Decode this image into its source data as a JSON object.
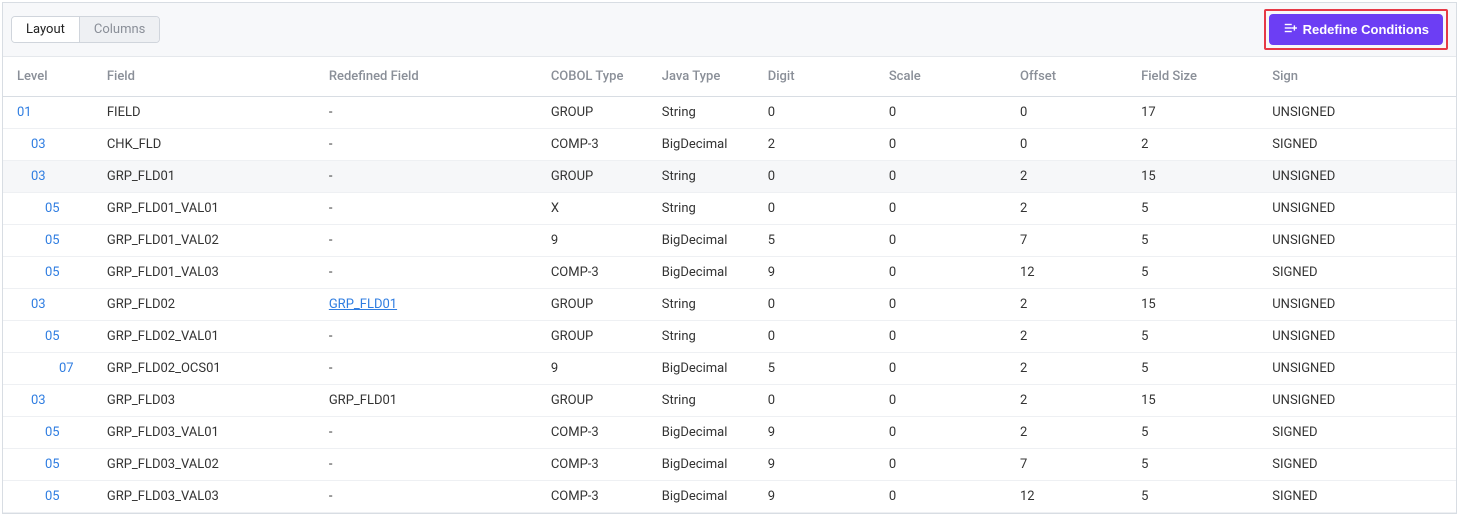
{
  "tabs": {
    "layout": "Layout",
    "columns": "Columns"
  },
  "button": {
    "redefine": "Redefine Conditions"
  },
  "columns": {
    "level": "Level",
    "field": "Field",
    "redefined": "Redefined Field",
    "cobol": "COBOL Type",
    "java": "Java Type",
    "digit": "Digit",
    "scale": "Scale",
    "offset": "Offset",
    "size": "Field Size",
    "sign": "Sign"
  },
  "rows": [
    {
      "level": "01",
      "indent": 0,
      "field": "FIELD",
      "redef": "-",
      "redefLink": false,
      "cobol": "GROUP",
      "java": "String",
      "digit": "0",
      "scale": "0",
      "offset": "0",
      "size": "17",
      "sign": "UNSIGNED",
      "hl": false
    },
    {
      "level": "03",
      "indent": 1,
      "field": "CHK_FLD",
      "redef": "-",
      "redefLink": false,
      "cobol": "COMP-3",
      "java": "BigDecimal",
      "digit": "2",
      "scale": "0",
      "offset": "0",
      "size": "2",
      "sign": "SIGNED",
      "hl": false
    },
    {
      "level": "03",
      "indent": 1,
      "field": "GRP_FLD01",
      "redef": "-",
      "redefLink": false,
      "cobol": "GROUP",
      "java": "String",
      "digit": "0",
      "scale": "0",
      "offset": "2",
      "size": "15",
      "sign": "UNSIGNED",
      "hl": true
    },
    {
      "level": "05",
      "indent": 2,
      "field": "GRP_FLD01_VAL01",
      "redef": "-",
      "redefLink": false,
      "cobol": "X",
      "java": "String",
      "digit": "0",
      "scale": "0",
      "offset": "2",
      "size": "5",
      "sign": "UNSIGNED",
      "hl": false
    },
    {
      "level": "05",
      "indent": 2,
      "field": "GRP_FLD01_VAL02",
      "redef": "-",
      "redefLink": false,
      "cobol": "9",
      "java": "BigDecimal",
      "digit": "5",
      "scale": "0",
      "offset": "7",
      "size": "5",
      "sign": "UNSIGNED",
      "hl": false
    },
    {
      "level": "05",
      "indent": 2,
      "field": "GRP_FLD01_VAL03",
      "redef": "-",
      "redefLink": false,
      "cobol": "COMP-3",
      "java": "BigDecimal",
      "digit": "9",
      "scale": "0",
      "offset": "12",
      "size": "5",
      "sign": "SIGNED",
      "hl": false
    },
    {
      "level": "03",
      "indent": 1,
      "field": "GRP_FLD02",
      "redef": "GRP_FLD01",
      "redefLink": true,
      "cobol": "GROUP",
      "java": "String",
      "digit": "0",
      "scale": "0",
      "offset": "2",
      "size": "15",
      "sign": "UNSIGNED",
      "hl": false
    },
    {
      "level": "05",
      "indent": 2,
      "field": "GRP_FLD02_VAL01",
      "redef": "-",
      "redefLink": false,
      "cobol": "GROUP",
      "java": "String",
      "digit": "0",
      "scale": "0",
      "offset": "2",
      "size": "5",
      "sign": "UNSIGNED",
      "hl": false
    },
    {
      "level": "07",
      "indent": 3,
      "field": "GRP_FLD02_OCS01",
      "redef": "-",
      "redefLink": false,
      "cobol": "9",
      "java": "BigDecimal",
      "digit": "5",
      "scale": "0",
      "offset": "2",
      "size": "5",
      "sign": "UNSIGNED",
      "hl": false
    },
    {
      "level": "03",
      "indent": 1,
      "field": "GRP_FLD03",
      "redef": "GRP_FLD01",
      "redefLink": false,
      "cobol": "GROUP",
      "java": "String",
      "digit": "0",
      "scale": "0",
      "offset": "2",
      "size": "15",
      "sign": "UNSIGNED",
      "hl": false
    },
    {
      "level": "05",
      "indent": 2,
      "field": "GRP_FLD03_VAL01",
      "redef": "-",
      "redefLink": false,
      "cobol": "COMP-3",
      "java": "BigDecimal",
      "digit": "9",
      "scale": "0",
      "offset": "2",
      "size": "5",
      "sign": "SIGNED",
      "hl": false
    },
    {
      "level": "05",
      "indent": 2,
      "field": "GRP_FLD03_VAL02",
      "redef": "-",
      "redefLink": false,
      "cobol": "COMP-3",
      "java": "BigDecimal",
      "digit": "9",
      "scale": "0",
      "offset": "7",
      "size": "5",
      "sign": "SIGNED",
      "hl": false
    },
    {
      "level": "05",
      "indent": 2,
      "field": "GRP_FLD03_VAL03",
      "redef": "-",
      "redefLink": false,
      "cobol": "COMP-3",
      "java": "BigDecimal",
      "digit": "9",
      "scale": "0",
      "offset": "12",
      "size": "5",
      "sign": "SIGNED",
      "hl": false
    }
  ]
}
